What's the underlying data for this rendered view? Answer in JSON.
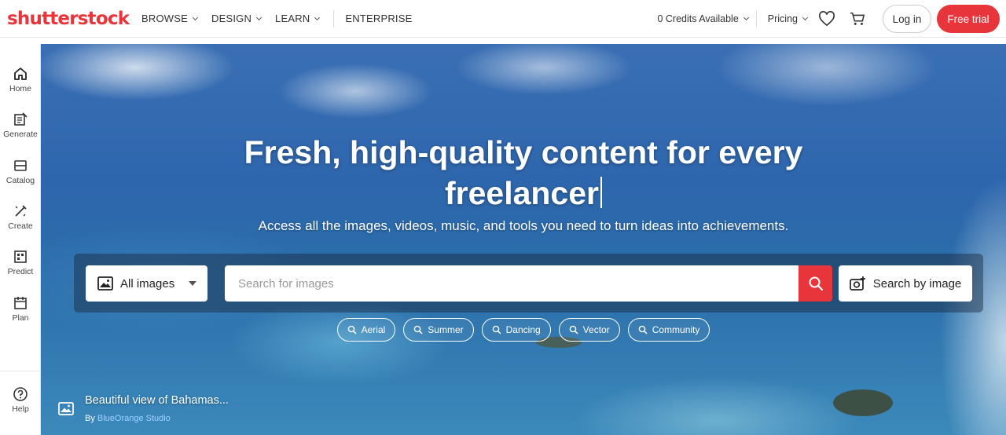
{
  "header": {
    "logo": "shutterstock",
    "nav": [
      {
        "label": "BROWSE"
      },
      {
        "label": "DESIGN"
      },
      {
        "label": "LEARN"
      }
    ],
    "enterprise_label": "ENTERPRISE",
    "credits_label": "0 Credits Available",
    "pricing_label": "Pricing",
    "login_label": "Log in",
    "trial_label": "Free trial",
    "brand_color": "#e8353b"
  },
  "sidebar": {
    "items": [
      {
        "label": "Home",
        "icon": "home-icon"
      },
      {
        "label": "Generate",
        "icon": "generate-icon"
      },
      {
        "label": "Catalog",
        "icon": "catalog-icon"
      },
      {
        "label": "Create",
        "icon": "create-icon"
      },
      {
        "label": "Predict",
        "icon": "predict-icon"
      },
      {
        "label": "Plan",
        "icon": "plan-icon"
      }
    ],
    "help_label": "Help"
  },
  "hero": {
    "headline_line1": "Fresh, high-quality content for every",
    "headline_line2": "freelancer",
    "subheadline": "Access all the images, videos, music, and tools you need to turn ideas into achievements.",
    "search": {
      "type_label": "All images",
      "placeholder": "Search for images",
      "value": "",
      "by_image_label": "Search by image"
    },
    "chips": [
      {
        "label": "Aerial"
      },
      {
        "label": "Summer"
      },
      {
        "label": "Dancing"
      },
      {
        "label": "Vector"
      },
      {
        "label": "Community"
      }
    ],
    "photo_title": "Beautiful view of Bahamas...",
    "photo_by_prefix": "By",
    "photo_author": "BlueOrange Studio"
  }
}
